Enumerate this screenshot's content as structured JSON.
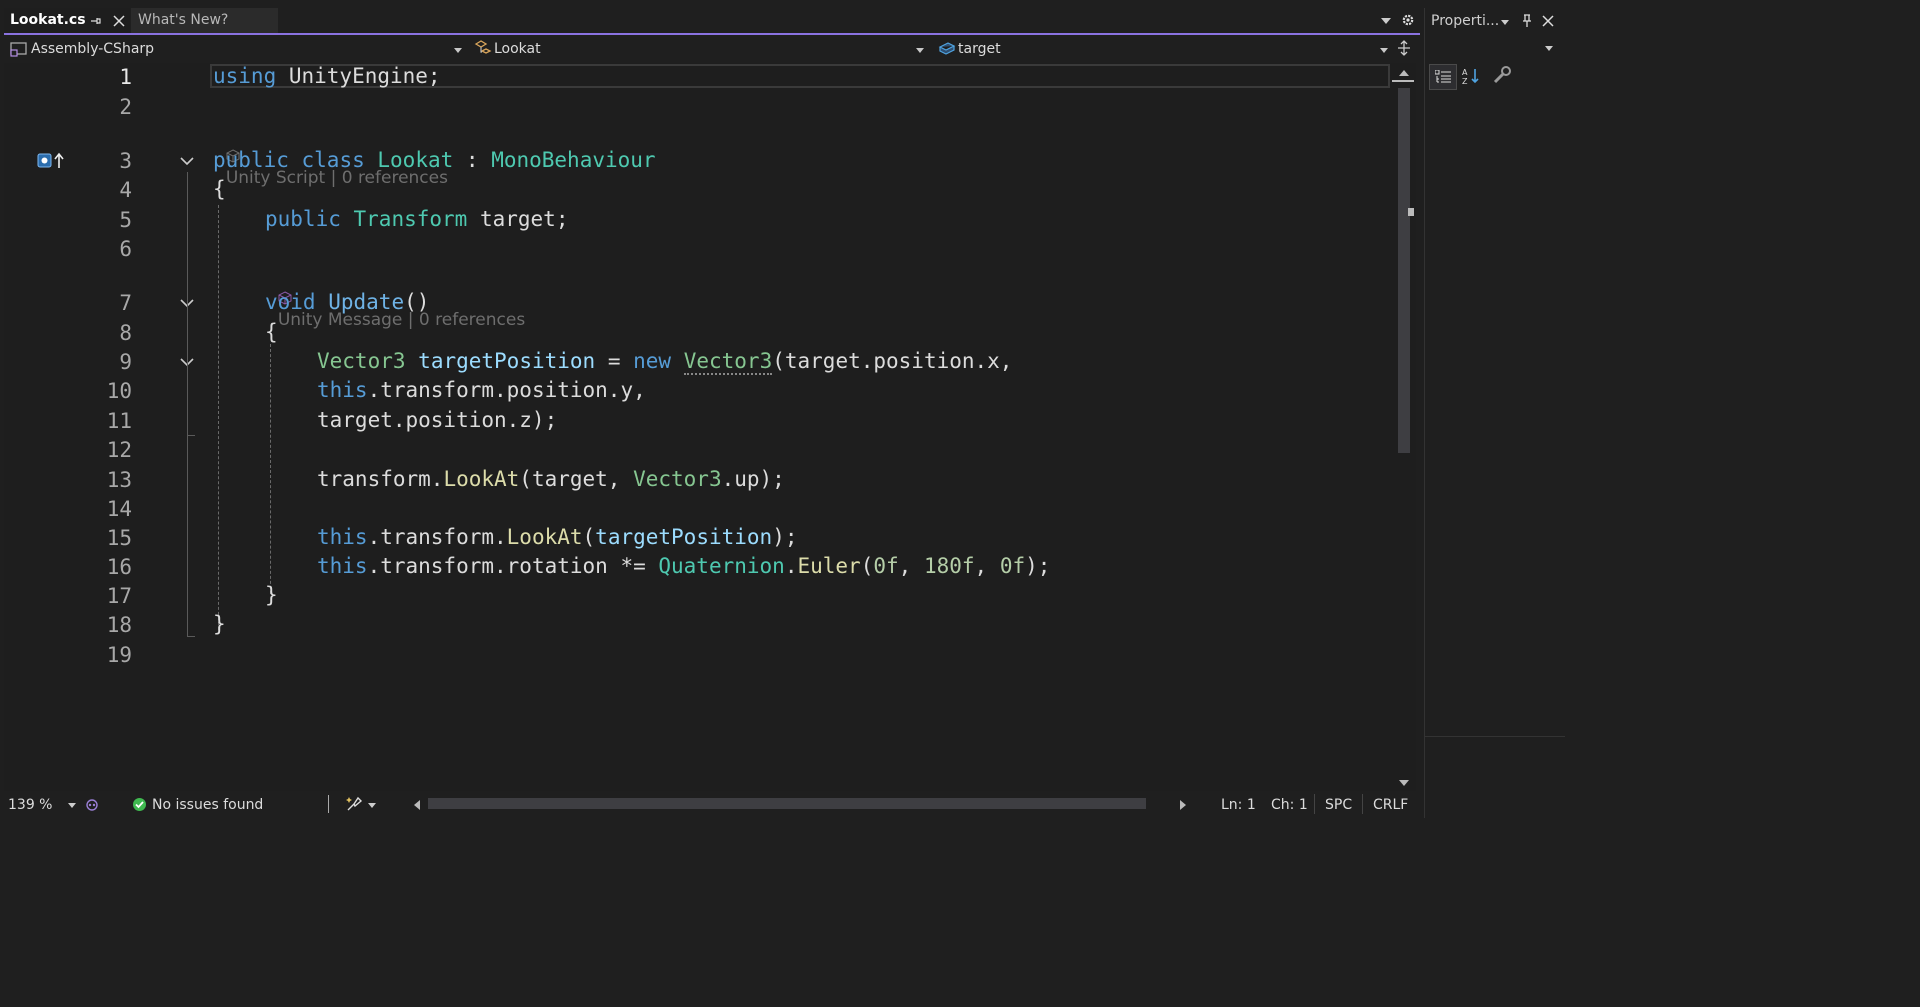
{
  "tabs": [
    {
      "label": "Lookat.cs",
      "active": true
    },
    {
      "label": "What's New?",
      "active": false
    }
  ],
  "navbar": {
    "project": "Assembly-CSharp",
    "class": "Lookat",
    "member": "target"
  },
  "editor": {
    "line_numbers": [
      "1",
      "2",
      "3",
      "4",
      "5",
      "6",
      "7",
      "8",
      "9",
      "10",
      "11",
      "12",
      "13",
      "14",
      "15",
      "16",
      "17",
      "18",
      "19"
    ],
    "codelens": [
      {
        "text": "Unity Script | 0 references"
      },
      {
        "text": "Unity Message | 0 references"
      }
    ],
    "tokens": {
      "l1": [
        "using",
        " UnityEngine;"
      ],
      "l3": [
        "public",
        " ",
        "class",
        " ",
        "Lookat",
        " : ",
        "MonoBehaviour"
      ],
      "l4": [
        "{"
      ],
      "l5": [
        "public",
        " ",
        "Transform",
        " target;"
      ],
      "l7": [
        "void",
        " ",
        "Update",
        "()"
      ],
      "l8": [
        "{"
      ],
      "l9": [
        "Vector3",
        " ",
        "targetPosition",
        " = ",
        "new",
        " ",
        "Vector3",
        "(target.position.x,"
      ],
      "l10": [
        "this",
        ".transform.position.y,"
      ],
      "l11": [
        "target.position.z);"
      ],
      "l13": [
        "transform.",
        "LookAt",
        "(target, ",
        "Vector3",
        ".up);"
      ],
      "l15": [
        "this",
        ".transform.",
        "LookAt",
        "(",
        "targetPosition",
        ");"
      ],
      "l16": [
        "this",
        ".transform.rotation *= ",
        "Quaternion",
        ".",
        "Euler",
        "(",
        "0f",
        ", ",
        "180f",
        ", ",
        "0f",
        ");"
      ],
      "l17": [
        "}"
      ],
      "l18": [
        "}"
      ]
    }
  },
  "status": {
    "zoom": "139 %",
    "issues": "No issues found",
    "line": "Ln: 1",
    "char": "Ch: 1",
    "whitespace": "SPC",
    "line_ending": "CRLF"
  },
  "properties_panel": {
    "title": "Properti..."
  },
  "colors": {
    "accent": "#8a72e0",
    "keyword": "#569cd6",
    "type": "#4ec9b0",
    "method": "#dcdcaa",
    "variable": "#9cdcfe",
    "number": "#b5cea8",
    "ok_green": "#3fb950"
  }
}
